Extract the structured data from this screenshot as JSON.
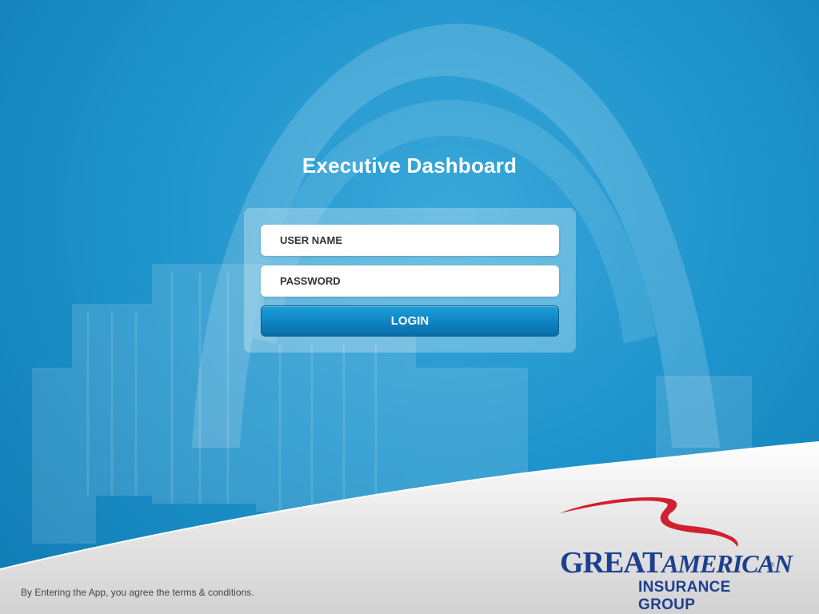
{
  "app": {
    "title": "Executive Dashboard"
  },
  "login": {
    "username_placeholder": "USER NAME",
    "password_placeholder": "PASSWORD",
    "login_label": "LOGIN"
  },
  "footer": {
    "terms_text": "By Entering the App, you agree the terms & conditions."
  },
  "logo": {
    "line1_great": "GREAT",
    "line1_american": "AMERICAN",
    "registered": "®",
    "line2": "INSURANCE GROUP"
  },
  "colors": {
    "background": "#1b8fc8",
    "button": "#0f86c4",
    "logo_blue": "#1d3f8f",
    "logo_red": "#d1202f"
  },
  "icons": {
    "logo_mark": "eagle-swoosh-icon"
  }
}
